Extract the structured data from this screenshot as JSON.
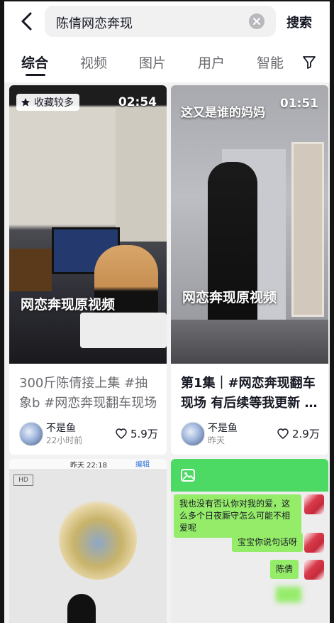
{
  "search": {
    "query": "陈倩网恋奔现",
    "button_label": "搜索"
  },
  "tabs": [
    {
      "label": "综合",
      "active": true
    },
    {
      "label": "视频",
      "active": false
    },
    {
      "label": "图片",
      "active": false
    },
    {
      "label": "用户",
      "active": false
    },
    {
      "label": "智能",
      "active": false
    }
  ],
  "results": [
    {
      "badge": "收藏较多",
      "duration": "02:54",
      "overlay": "网恋奔现原视频",
      "title": "300斤陈倩接上集 #抽象b #网恋奔现翻车现场",
      "author": "不是鱼",
      "time": "22小时前",
      "likes": "5.9万"
    },
    {
      "caption": "这又是谁的妈妈",
      "duration": "01:51",
      "overlay": "网恋奔现原视频",
      "title": "第1集｜#网恋奔现翻车现场 有后续等我更新 …",
      "author": "不是鱼",
      "time": "昨天",
      "likes": "2.9万"
    },
    {
      "stamp_left": "昨天 22:18",
      "stamp_right": "编辑"
    },
    {
      "messages": [
        "我也没有否认你对我的爱，这么多个日夜厮守怎么可能不相爱呢",
        "宝宝你说句话呀",
        "陈倩"
      ]
    }
  ],
  "colors": {
    "chat_bubble": "#95ec69",
    "chat_header": "#4cd964"
  }
}
